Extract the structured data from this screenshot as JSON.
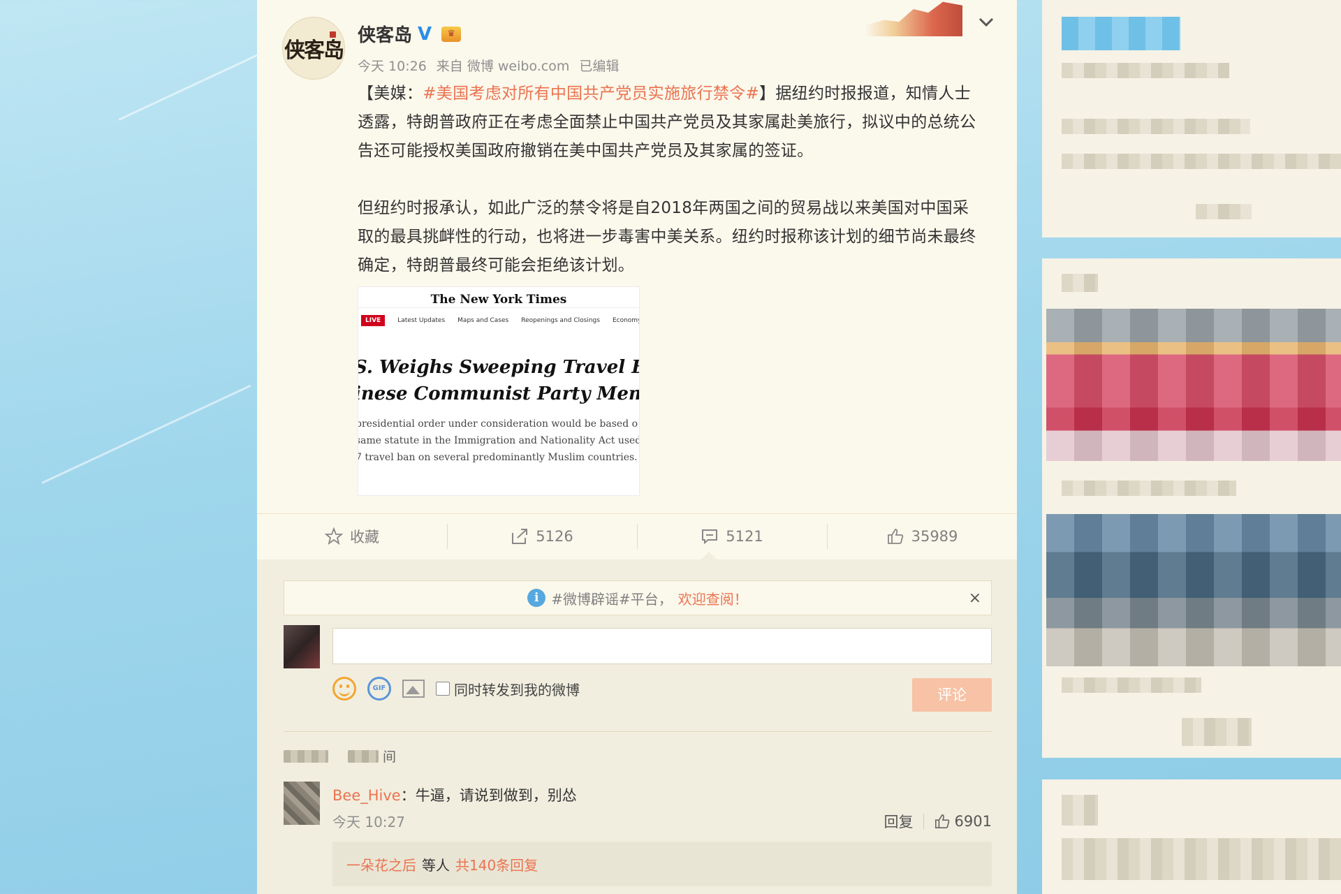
{
  "post": {
    "author": "侠客岛",
    "avatar_text": "侠客岛",
    "vip_badge": "V",
    "meta": {
      "time": "今天 10:26",
      "source": "来自 微博 weibo.com",
      "edited": "已编辑"
    },
    "text": {
      "p1_prefix": "【美媒：",
      "p1_topic": "#美国考虑对所有中国共产党员实施旅行禁令#",
      "p1_rest": "】据纽约时报报道，知情人士透露，特朗普政府正在考虑全面禁止中国共产党员及其家属赴美旅行，拟议中的总统公告还可能授权美国政府撤销在美中国共产党员及其家属的签证。",
      "p2": "但纽约时报承认，如此广泛的禁令将是自2018年两国之间的贸易战以来美国对中国采取的最具挑衅性的行动，也将进一步毒害中美关系。纽约时报称该计划的细节尚未最终确定，特朗普最终可能会拒绝该计划。"
    },
    "image": {
      "masthead": "The New York Times",
      "live": "LIVE",
      "nav": [
        "Latest Updates",
        "Maps and Cases",
        "Reopenings and Closings",
        "Economy and Ma"
      ],
      "headline_1": "S. Weighs Sweeping Travel Ban on",
      "headline_2": "inese Communist Party Members",
      "body_1": "presidential order under consideration would be based o",
      "body_2": "same statute in the Immigration and Nationality Act used",
      "body_3": "7 travel ban on several predominantly Muslim countries."
    }
  },
  "actions": {
    "favorite": "收藏",
    "repost": "5126",
    "comment": "5121",
    "like": "35989"
  },
  "notice": {
    "topic": "#微博辟谣#平台，",
    "link": "欢迎查阅！",
    "close": "×"
  },
  "composer": {
    "gif_label": "GIF",
    "repost_label": "同时转发到我的微博",
    "submit": "评论"
  },
  "sort": {
    "tail": "间"
  },
  "comment": {
    "user": "Bee_Hive",
    "text": "：牛逼，请说到做到，别怂",
    "time": "今天 10:27",
    "reply_label": "回复",
    "likes": "6901",
    "replies_user": "一朵花之后",
    "replies_mid": "等人",
    "replies_total": "共140条回复"
  },
  "colors": {
    "accent": "#eb7350",
    "link_blue": "#2a8ee6",
    "card_bg": "#fbf8ec",
    "comment_bg": "#f1eedf",
    "submit_bg": "#f7c2a5"
  }
}
